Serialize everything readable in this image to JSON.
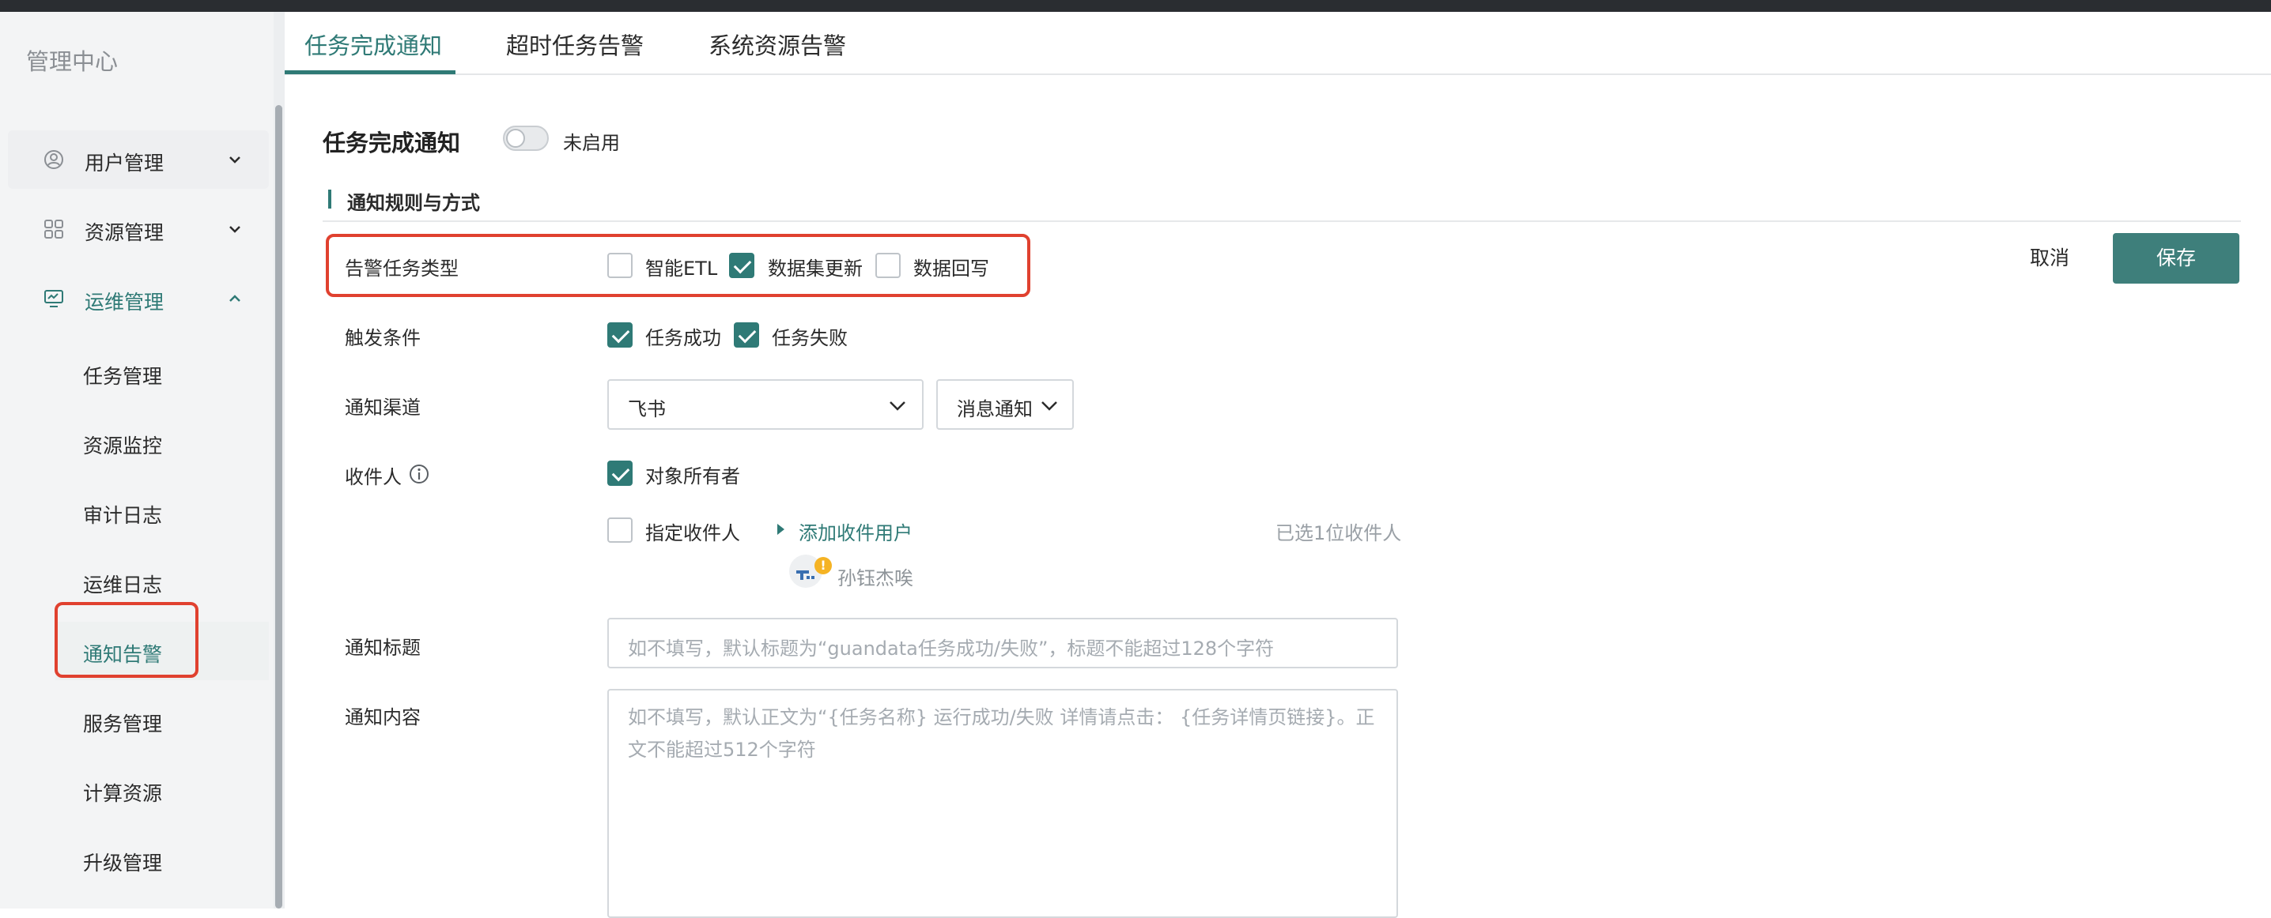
{
  "sidebar": {
    "title": "管理中心",
    "menu": [
      {
        "label": "用户管理",
        "icon": "user-circle-icon",
        "expanded": false
      },
      {
        "label": "资源管理",
        "icon": "grid-icon",
        "expanded": false
      },
      {
        "label": "运维管理",
        "icon": "monitor-icon",
        "expanded": true
      }
    ],
    "sub_items": [
      "任务管理",
      "资源监控",
      "审计日志",
      "运维日志",
      "通知告警",
      "服务管理",
      "计算资源",
      "升级管理"
    ],
    "active_sub_item": "通知告警"
  },
  "tabs": [
    "任务完成通知",
    "超时任务告警",
    "系统资源告警"
  ],
  "active_tab": "任务完成通知",
  "section": {
    "title": "任务完成通知",
    "toggle_label": "未启用",
    "toggle_on": false,
    "subsection_title": "通知规则与方式"
  },
  "form": {
    "task_type": {
      "label": "告警任务类型",
      "options": [
        {
          "label": "智能ETL",
          "checked": false
        },
        {
          "label": "数据集更新",
          "checked": true
        },
        {
          "label": "数据回写",
          "checked": false
        }
      ]
    },
    "trigger": {
      "label": "触发条件",
      "options": [
        {
          "label": "任务成功",
          "checked": true
        },
        {
          "label": "任务失败",
          "checked": true
        }
      ]
    },
    "channel": {
      "label": "通知渠道",
      "channel_value": "飞书",
      "type_value": "消息通知"
    },
    "recipients": {
      "label": "收件人",
      "owner_label": "对象所有者",
      "owner_checked": true,
      "specified_label": "指定收件人",
      "specified_checked": false,
      "add_link": "添加收件用户",
      "selected_count": "已选1位收件人",
      "user_name": "孙钰杰唉",
      "avatar_badge": "!"
    },
    "title": {
      "label": "通知标题",
      "placeholder": "如不填写，默认标题为“guandata任务成功/失败”，标题不能超过128个字符"
    },
    "content": {
      "label": "通知内容",
      "placeholder": "如不填写，默认正文为“{任务名称} 运行成功/失败 详情请点击： {任务详情页链接}。正文不能超过512个字符"
    }
  },
  "actions": {
    "cancel": "取消",
    "save": "保存"
  },
  "colors": {
    "accent": "#2f7a76",
    "save_button": "#3e7f7b",
    "highlight_box": "#e0412f"
  }
}
